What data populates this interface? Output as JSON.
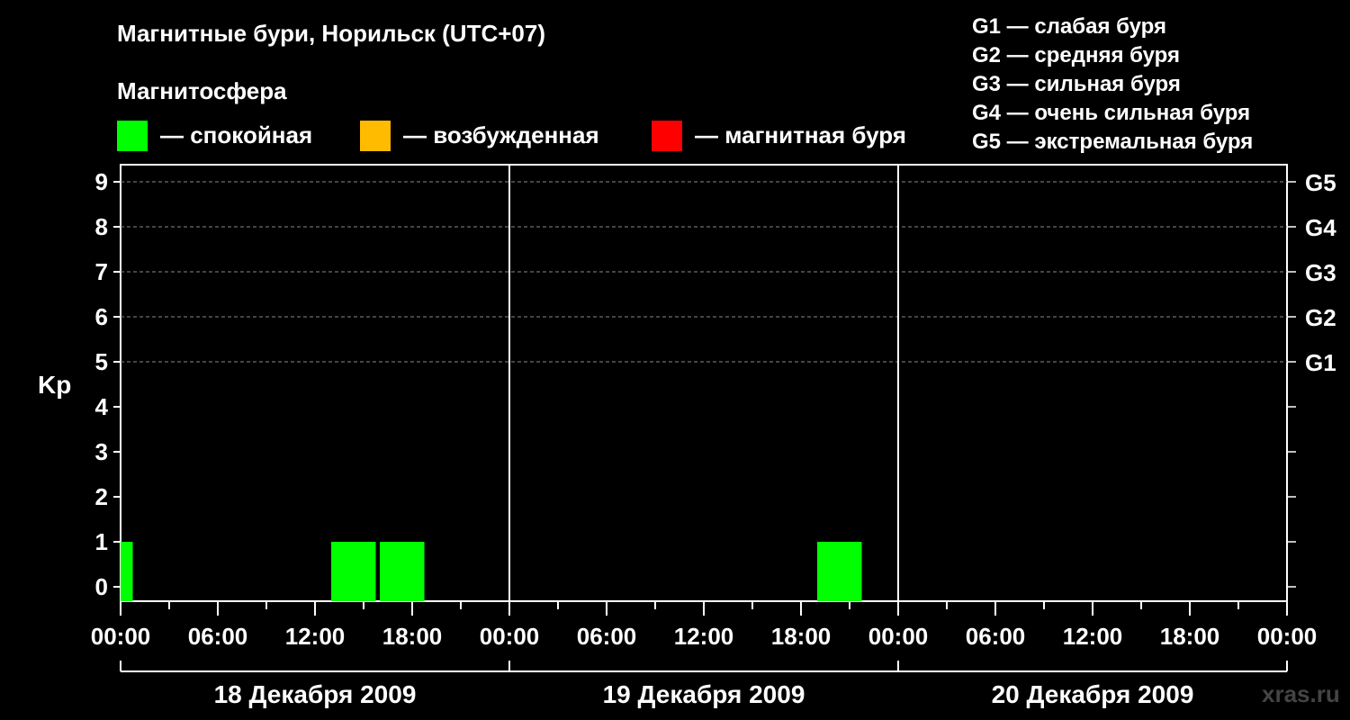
{
  "chart_data": {
    "type": "bar",
    "title": "Магнитные бури, Норильск (UTC+07)",
    "ylabel": "Kp",
    "ylim": [
      0,
      9
    ],
    "yticks": [
      "0",
      "1",
      "2",
      "3",
      "4",
      "5",
      "6",
      "7",
      "8",
      "9"
    ],
    "right_axis_labels": [
      {
        "kp": 5,
        "label": "G1"
      },
      {
        "kp": 6,
        "label": "G2"
      },
      {
        "kp": 7,
        "label": "G3"
      },
      {
        "kp": 8,
        "label": "G4"
      },
      {
        "kp": 9,
        "label": "G5"
      }
    ],
    "xlim_hours": [
      0,
      72
    ],
    "x_tick_labels": [
      "00:00",
      "06:00",
      "12:00",
      "18:00",
      "00:00",
      "06:00",
      "12:00",
      "18:00",
      "00:00",
      "06:00",
      "12:00",
      "18:00",
      "00:00"
    ],
    "days": [
      "18 Декабря 2009",
      "19 Декабря 2009",
      "20 Декабря 2009"
    ],
    "grid": "dashed horizontal lines at Kp 5–9",
    "bars": [
      {
        "start_hour": 0,
        "end_hour": 0.75,
        "kp": 1,
        "state": "calm"
      },
      {
        "start_hour": 13,
        "end_hour": 15.75,
        "kp": 1,
        "state": "calm"
      },
      {
        "start_hour": 16,
        "end_hour": 18.75,
        "kp": 1,
        "state": "calm"
      },
      {
        "start_hour": 43,
        "end_hour": 45.75,
        "kp": 1,
        "state": "calm"
      }
    ]
  },
  "legend": {
    "header": "Магнитосфера",
    "items": [
      {
        "label": "— спокойная",
        "color": "#00ff00",
        "key": "calm"
      },
      {
        "label": "— возбужденная",
        "color": "#ffbb00",
        "key": "excited"
      },
      {
        "label": "— магнитная буря",
        "color": "#ff0000",
        "key": "storm"
      }
    ]
  },
  "g_scale": [
    "G1 — слабая буря",
    "G2 — средняя буря",
    "G3 — сильная буря",
    "G4 — очень сильная буря",
    "G5 — экстремальная буря"
  ],
  "watermark": "xras.ru"
}
